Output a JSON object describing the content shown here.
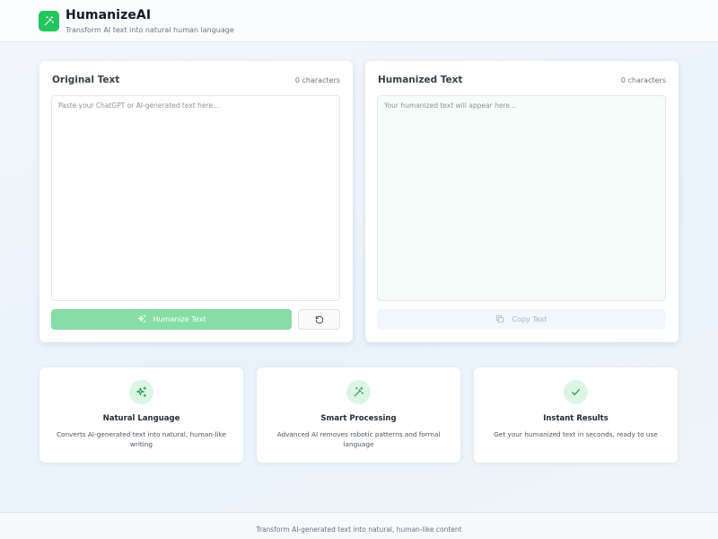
{
  "header": {
    "title": "HumanizeAI",
    "subtitle": "Transform AI text into natural human language",
    "logo_icon": "wand-sparkles-icon"
  },
  "input_panel": {
    "title": "Original Text",
    "char_count": "0 characters",
    "placeholder": "Paste your ChatGPT or AI-generated text here...",
    "value": "",
    "humanize_button": "Humanize Text",
    "humanize_icon": "sparkles-icon",
    "reset_icon": "rotate-ccw-icon"
  },
  "output_panel": {
    "title": "Humanized Text",
    "char_count": "0 characters",
    "placeholder": "Your humanized text will appear here...",
    "copy_button": "Copy Text",
    "copy_icon": "copy-icon"
  },
  "features": [
    {
      "icon": "sparkles-icon",
      "title": "Natural Language",
      "desc": "Converts AI-generated text into natural, human-like writing"
    },
    {
      "icon": "wand-sparkles-icon",
      "title": "Smart Processing",
      "desc": "Advanced AI removes robotic patterns and formal language"
    },
    {
      "icon": "check-icon",
      "title": "Instant Results",
      "desc": "Get your humanized text in seconds, ready to use"
    }
  ],
  "footer": {
    "text": "Transform AI-generated text into natural, human-like content"
  },
  "colors": {
    "accent": "#22c55e",
    "button_disabled": "#86dea6",
    "icon_bg": "#dcf5e5"
  }
}
